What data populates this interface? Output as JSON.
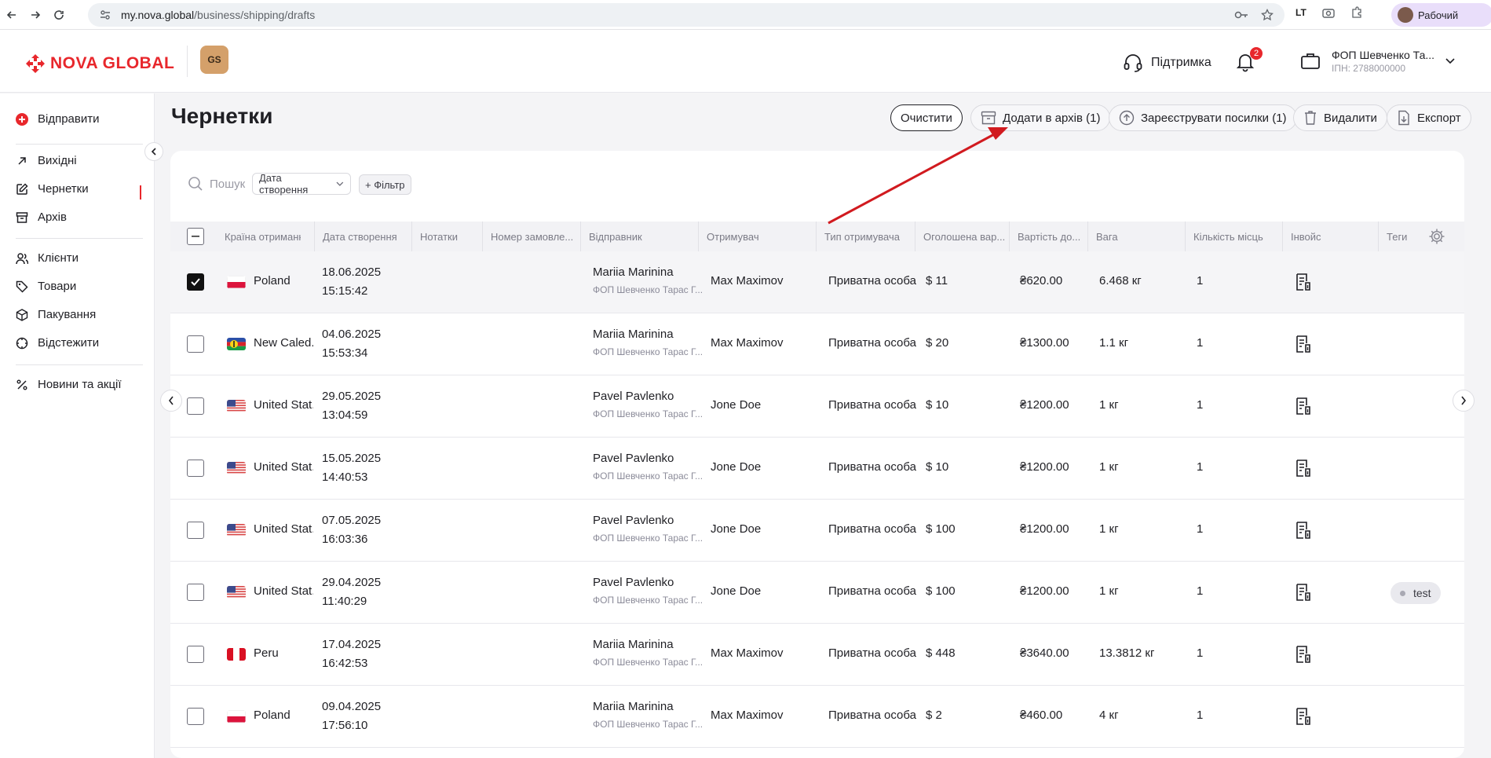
{
  "browser": {
    "url_domain": "my.nova.global",
    "url_path": "/business/shipping/drafts",
    "profile_label": "Рабочий"
  },
  "header": {
    "logo_text": "NOVA GLOBAL",
    "gs_badge": "GS",
    "support_label": "Підтримка",
    "notifications_count": "2",
    "account_name": "ФОП Шевченко Та...",
    "account_tax": "ІПН: 2788000000"
  },
  "sidebar": {
    "send_label": "Відправити",
    "items": [
      {
        "label": "Вихідні",
        "icon": "arrow-up-right-icon"
      },
      {
        "label": "Чернетки",
        "icon": "edit-icon"
      },
      {
        "label": "Архів",
        "icon": "archive-icon"
      },
      {
        "label": "Клієнти",
        "icon": "users-icon"
      },
      {
        "label": "Товари",
        "icon": "tag-icon"
      },
      {
        "label": "Пакування",
        "icon": "box-icon"
      },
      {
        "label": "Відстежити",
        "icon": "track-icon"
      },
      {
        "label": "Новини та акції",
        "icon": "percent-icon"
      }
    ]
  },
  "page": {
    "title": "Чернетки",
    "actions": {
      "clear": "Очистити",
      "archive": "Додати в архів (1)",
      "register": "Зареєструвати посилки (1)",
      "delete": "Видалити",
      "export": "Експорт"
    }
  },
  "toolbar": {
    "search_placeholder": "Пошук",
    "date_select": "Дата створення",
    "filter": "+ Фільтр"
  },
  "table": {
    "columns": [
      "Країна отримання",
      "Дата створення",
      "Нотатки",
      "Номер замовле...",
      "Відправник",
      "Отримувач",
      "Тип отримувача",
      "Оголошена вар...",
      "Вартість до...",
      "Вага",
      "Кількість місць",
      "Інвойс",
      "Теги"
    ],
    "rows": [
      {
        "selected": true,
        "flag": "pl",
        "country": "Poland",
        "date": "18.06.2025",
        "time": "15:15:42",
        "sender": "Mariia Marinina",
        "sender_sub": "ФОП Шевченко Тарас Г...",
        "recipient": "Max Maximov",
        "recipient_type": "Приватна особа",
        "declared": "$ 11",
        "cost": "₴620.00",
        "weight": "6.468 кг",
        "places": "1",
        "tag": ""
      },
      {
        "selected": false,
        "flag": "nc",
        "country": "New Caled...",
        "date": "04.06.2025",
        "time": "15:53:34",
        "sender": "Mariia Marinina",
        "sender_sub": "ФОП Шевченко Тарас Г...",
        "recipient": "Max Maximov",
        "recipient_type": "Приватна особа",
        "declared": "$ 20",
        "cost": "₴1300.00",
        "weight": "1.1 кг",
        "places": "1",
        "tag": ""
      },
      {
        "selected": false,
        "flag": "us",
        "country": "United Stat...",
        "date": "29.05.2025",
        "time": "13:04:59",
        "sender": "Pavel Pavlenko",
        "sender_sub": "ФОП Шевченко Тарас Г...",
        "recipient": "Jone Doe",
        "recipient_type": "Приватна особа",
        "declared": "$ 10",
        "cost": "₴1200.00",
        "weight": "1 кг",
        "places": "1",
        "tag": ""
      },
      {
        "selected": false,
        "flag": "us",
        "country": "United Stat...",
        "date": "15.05.2025",
        "time": "14:40:53",
        "sender": "Pavel Pavlenko",
        "sender_sub": "ФОП Шевченко Тарас Г...",
        "recipient": "Jone Doe",
        "recipient_type": "Приватна особа",
        "declared": "$ 10",
        "cost": "₴1200.00",
        "weight": "1 кг",
        "places": "1",
        "tag": ""
      },
      {
        "selected": false,
        "flag": "us",
        "country": "United Stat...",
        "date": "07.05.2025",
        "time": "16:03:36",
        "sender": "Pavel Pavlenko",
        "sender_sub": "ФОП Шевченко Тарас Г...",
        "recipient": "Jone Doe",
        "recipient_type": "Приватна особа",
        "declared": "$ 100",
        "cost": "₴1200.00",
        "weight": "1 кг",
        "places": "1",
        "tag": ""
      },
      {
        "selected": false,
        "flag": "us",
        "country": "United Stat...",
        "date": "29.04.2025",
        "time": "11:40:29",
        "sender": "Pavel Pavlenko",
        "sender_sub": "ФОП Шевченко Тарас Г...",
        "recipient": "Jone Doe",
        "recipient_type": "Приватна особа",
        "declared": "$ 100",
        "cost": "₴1200.00",
        "weight": "1 кг",
        "places": "1",
        "tag": "test"
      },
      {
        "selected": false,
        "flag": "pe",
        "country": "Peru",
        "date": "17.04.2025",
        "time": "16:42:53",
        "sender": "Mariia Marinina",
        "sender_sub": "ФОП Шевченко Тарас Г...",
        "recipient": "Max Maximov",
        "recipient_type": "Приватна особа",
        "declared": "$ 448",
        "cost": "₴3640.00",
        "weight": "13.3812 кг",
        "places": "1",
        "tag": ""
      },
      {
        "selected": false,
        "flag": "pl",
        "country": "Poland",
        "date": "09.04.2025",
        "time": "17:56:10",
        "sender": "Mariia Marinina",
        "sender_sub": "ФОП Шевченко Тарас Г...",
        "recipient": "Max Maximov",
        "recipient_type": "Приватна особа",
        "declared": "$ 2",
        "cost": "₴460.00",
        "weight": "4 кг",
        "places": "1",
        "tag": ""
      }
    ]
  },
  "colors": {
    "brand": "#e8272c",
    "annotation_arrow": "#d11a1f"
  }
}
